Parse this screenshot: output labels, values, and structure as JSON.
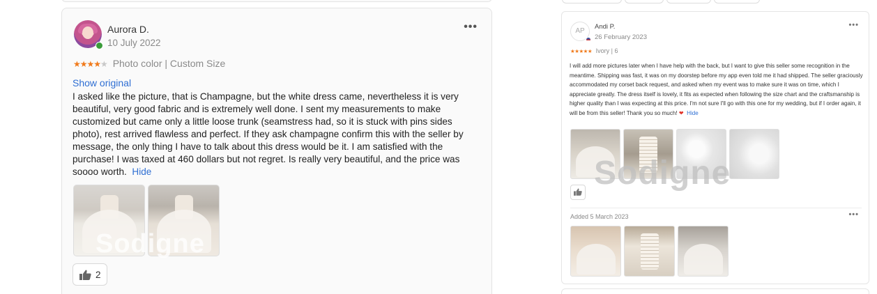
{
  "left_review": {
    "author": "Aurora D.",
    "date": "10 July 2022",
    "rating": 4,
    "stars_text": "★★★★",
    "stars_empty": "★",
    "attributes": "Photo color | Custom Size",
    "show_original": "Show original",
    "text": "I asked like the picture, that is Champagne, but the white dress came, nevertheless it is very beautiful, very good fabric and is extremely well done. I sent my measurements to make customized but came only a little loose trunk (seamstress had, so it is stuck with pins sides photo), rest arrived flawless and perfect. If they ask champagne confirm this with the seller by message, the only thing I have to talk about this dress would be it. I am satisfied with the purchase! I was taxed at 460 dollars but not regret. Is really very beautiful, and the price was soooo worth.",
    "hide": "Hide",
    "more": "•••",
    "watermark": "Sodigne",
    "likes": "2",
    "icons": [
      "thumbs-up-icon",
      "more-options-icon"
    ],
    "colors": {
      "star": "#f07a1b",
      "link": "#2f6fd3",
      "card_bg": "#fafafa"
    }
  },
  "right_review": {
    "avatar_initials": "AP",
    "author": "Andi P.",
    "date": "26 February 2023",
    "stars_text": "★★★★★",
    "attributes": "Ivory | 6",
    "text": "I will add more pictures later when I have help with the back, but I want to give this seller some recognition in the meantime. Shipping was fast, it was on my doorstep before my app even told me it had shipped. The seller graciously accommodated my corset back request, and asked when my event was to make sure it was on time, which I appreciate greatly. The dress itself is lovely, it fits as expected when following the size chart and the craftsmanship is higher quality than I was expecting at this price. I'm not sure I'll go with this one for my wedding, but if I order again, it will be from this seller! Thank you so much!",
    "heart": "❤",
    "hide": "Hide",
    "more": "•••",
    "watermark": "Sodigne",
    "added_date": "Added 5 March 2023",
    "icons": [
      "heart-icon",
      "thumbs-up-icon",
      "more-options-icon"
    ],
    "colors": {
      "heart": "#e2352b"
    }
  }
}
